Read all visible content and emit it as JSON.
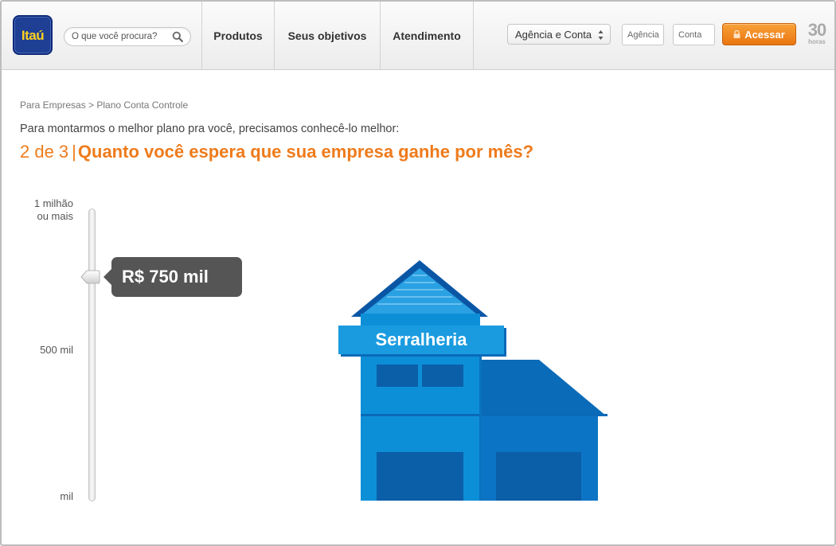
{
  "header": {
    "logo_text": "Itaú",
    "search": {
      "placeholder": "O que você procura?"
    },
    "nav": [
      "Produtos",
      "Seus objetivos",
      "Atendimento"
    ],
    "account_select": "Agência e Conta",
    "agencia_placeholder": "Agência",
    "conta_placeholder": "Conta",
    "access_button": "Acessar",
    "hours_badge": {
      "number": "30",
      "label": "horas"
    }
  },
  "breadcrumb": "Para Empresas > Plano Conta Controle",
  "intro": "Para montarmos o melhor plano pra você, precisamos conhecê-lo melhor:",
  "question": {
    "step": "2 de 3",
    "separator": "|",
    "text": "Quanto você espera que sua empresa ganhe por mês?"
  },
  "slider": {
    "top_label_line1": "1 milhão",
    "top_label_line2": "ou mais",
    "mid_label": "500 mil",
    "bottom_label": "mil",
    "value_label": "R$ 750 mil",
    "value_fraction": 0.75
  },
  "illustration": {
    "sign": "Serralheria"
  },
  "colors": {
    "accent": "#ee7b1b",
    "brand": "#1e3f94",
    "logo_text": "#ffd21f",
    "bubble": "#555555"
  }
}
